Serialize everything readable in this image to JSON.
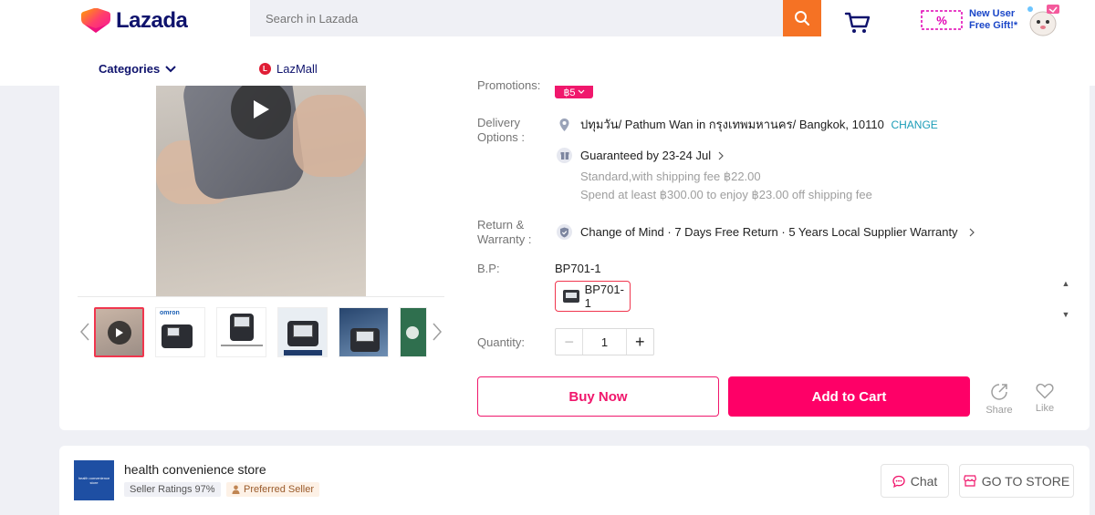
{
  "header": {
    "logo_text": "Lazada",
    "search_placeholder": "Search in Lazada",
    "promo_line1": "New User",
    "promo_line2": "Free Gift!*",
    "promo_tag_text": "%",
    "nav_categories": "Categories",
    "nav_lazmall": "LazMall",
    "lazmall_badge": "L"
  },
  "product": {
    "promotions_label": "Promotions:",
    "promo_badge": "฿5",
    "delivery_label_line1": "Delivery",
    "delivery_label_line2": "Options :",
    "address": "ปทุมวัน/ Pathum Wan in กรุงเทพมหานคร/ Bangkok, 10110",
    "change_link": "CHANGE",
    "guaranteed": "Guaranteed by 23-24 Jul",
    "shipping_fee": "Standard,with shipping fee ฿22.00",
    "shipping_offer": "Spend at least ฿300.00 to enjoy ฿23.00 off shipping fee",
    "return_label_line1": "Return &",
    "return_label_line2": "Warranty :",
    "warranty_text": "Change of Mind · 7 Days Free Return · 5 Years Local Supplier Warranty",
    "variant_label": "B.P:",
    "variant_selected": "BP701-1",
    "variant_option": "BP701-1",
    "quantity_label": "Quantity:",
    "quantity_value": "1",
    "qty_minus": "−",
    "qty_plus": "+",
    "buy_now": "Buy Now",
    "add_to_cart": "Add to Cart",
    "share_label": "Share",
    "like_label": "Like",
    "thumb_brand": "omron"
  },
  "store": {
    "logo_text": "health convenience store",
    "name": "health convenience store",
    "rating": "Seller Ratings 97%",
    "preferred": "Preferred Seller",
    "chat": "Chat",
    "go_to_store": "GO TO STORE"
  },
  "colors": {
    "brand_pink": "#fe0067",
    "search_orange": "#f57224",
    "link_blue": "#1a9cb7",
    "navy": "#0f136d"
  }
}
